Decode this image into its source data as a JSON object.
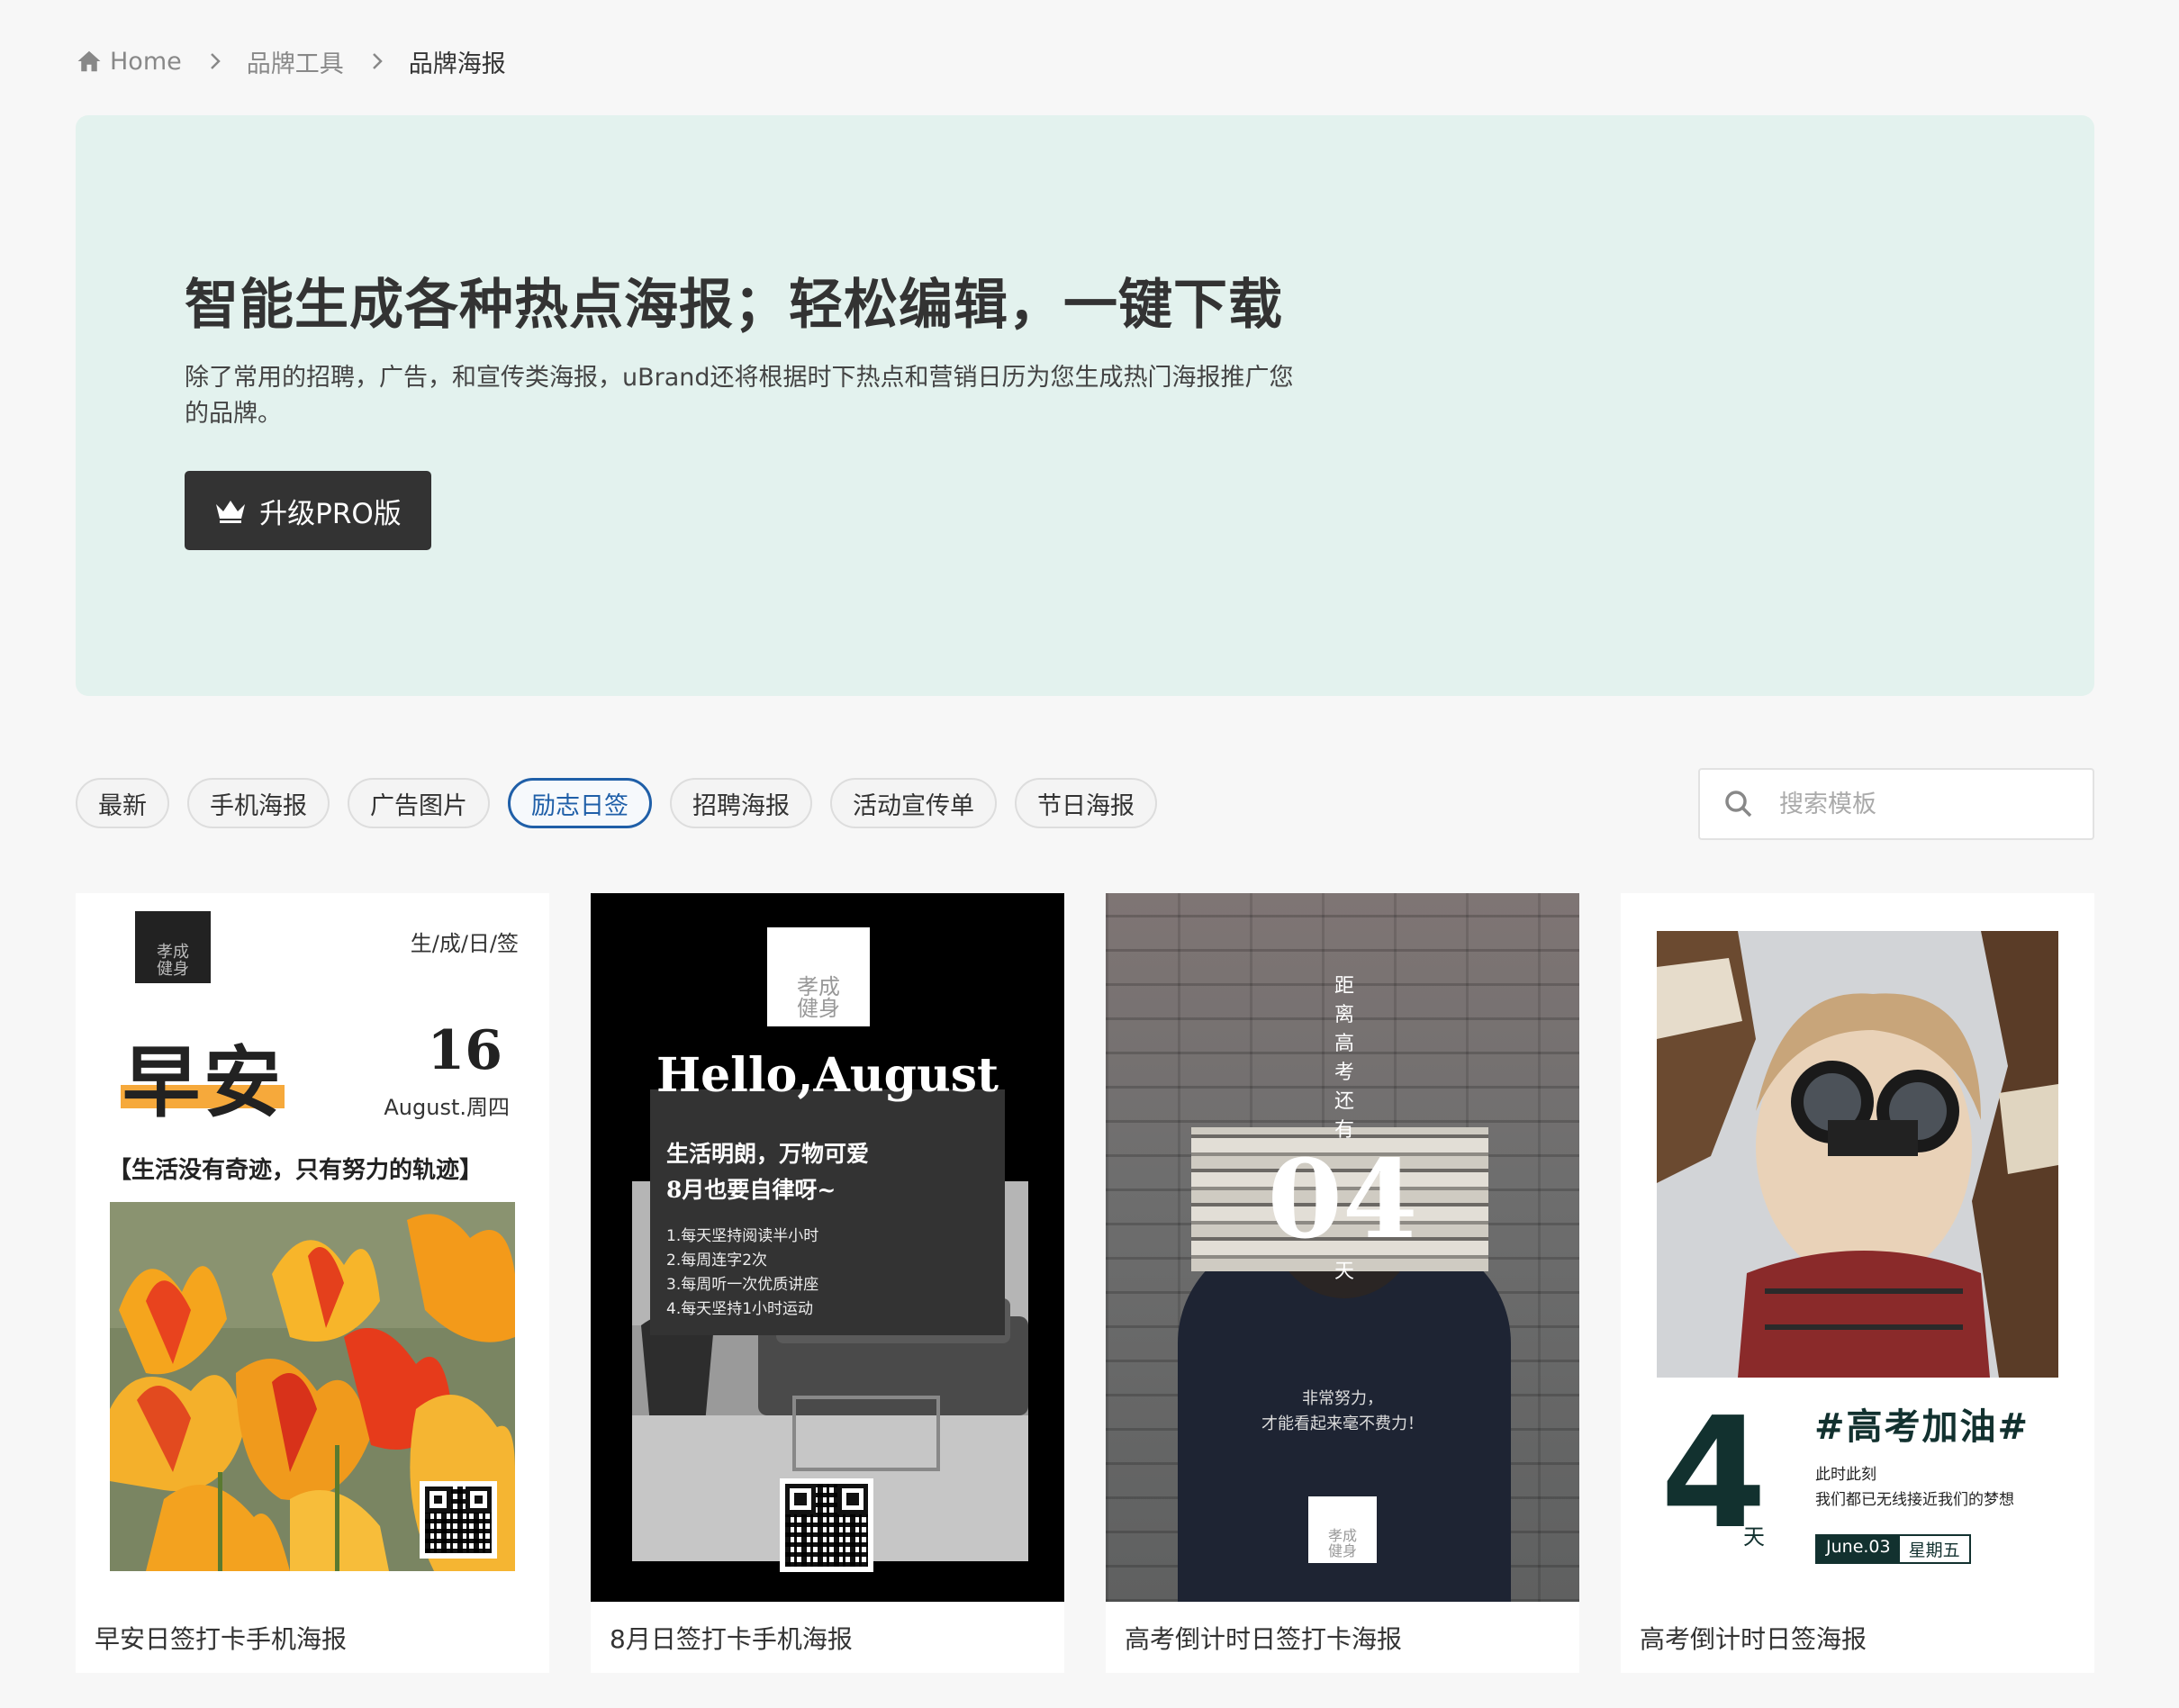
{
  "breadcrumb": {
    "home": "Home",
    "level1": "品牌工具",
    "current": "品牌海报"
  },
  "hero": {
    "title": "智能生成各种热点海报；轻松编辑，一键下载",
    "description": "除了常用的招聘，广告，和宣传类海报，uBrand还将根据时下热点和营销日历为您生成热门海报推广您的品牌。",
    "pro_button": "升级PRO版",
    "background": "#e3f2ee"
  },
  "filters": {
    "items": [
      "最新",
      "手机海报",
      "广告图片",
      "励志日签",
      "招聘海报",
      "活动宣传单",
      "节日海报"
    ],
    "active": "励志日签",
    "active_color": "#1f5fa8"
  },
  "search": {
    "placeholder": "搜索模板"
  },
  "cards": [
    {
      "title": "早安日签打卡手机海报",
      "poster": {
        "logo": "孝成\n健身",
        "tag": "生/成/日/签",
        "headline": "早安",
        "day": "16",
        "month": "August.周四",
        "quote": "【生活没有奇迹，只有努力的轨迹】"
      }
    },
    {
      "title": "8月日签打卡手机海报",
      "poster": {
        "logo": "孝成\n健身",
        "headline": "Hello,August",
        "line1": "生活明朗，万物可爱",
        "line2": "8月也要自律呀~",
        "list": [
          "1.每天坚持阅读半小时",
          "2.每周连字2次",
          "3.每周听一次优质讲座",
          "4.每天坚持1小时运动"
        ]
      }
    },
    {
      "title": "高考倒计时日签打卡海报",
      "poster": {
        "vertical": "距离高考还有",
        "number": "04",
        "unit": "天",
        "line1": "非常努力，",
        "line2": "才能看起来毫不费力！",
        "logo": "孝成\n健身"
      }
    },
    {
      "title": "高考倒计时日签海报",
      "poster": {
        "number": "4",
        "unit": "天",
        "tag": "#高考加油#",
        "line1": "此时此刻",
        "line2": "我们都已无线接近我们的梦想",
        "date": "June.03",
        "weekday": "星期五"
      }
    }
  ]
}
